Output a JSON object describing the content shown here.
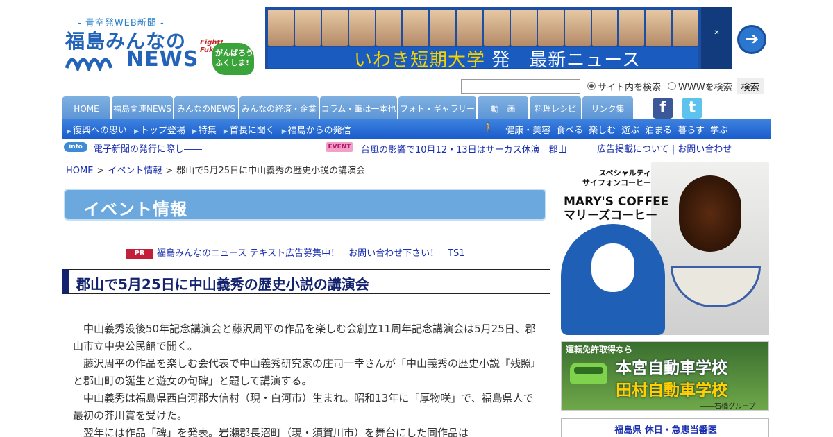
{
  "header": {
    "tagline": "- 青空発WEB新聞 -",
    "site_name": "福島みんなの",
    "site_news": "NEWS",
    "fight_label": "Fight! Fukushima",
    "ganbarou": "がんばろう ふくしま!",
    "banner_text_yellow": "いわき短期大学",
    "banner_text_white": "発　最新ニュース",
    "banner_school_logo": "いわき短期大学"
  },
  "search": {
    "radio_site": "サイト内を検索",
    "radio_www": "WWWを検索",
    "button": "検索",
    "selected": "site"
  },
  "nav": {
    "tabs": [
      "HOME",
      "福島関連NEWS",
      "みんなのNEWS",
      "みんなの経済・企業",
      "コラム・筆は一本也",
      "フォト・ギャラリー",
      "動　画",
      "料理レシピ",
      "リンク集"
    ],
    "social": [
      "facebook",
      "twitter"
    ]
  },
  "subnav": {
    "left": [
      "復興への思い",
      "トップ登場",
      "特集",
      "首長に聞く",
      "福島からの発信"
    ],
    "right": [
      "健康・美容",
      "食べる",
      "楽しむ",
      "遊ぶ",
      "泊まる",
      "暮らす",
      "学ぶ"
    ]
  },
  "infobar": {
    "info_badge": "info",
    "info_text": "電子新聞の発行に際し――",
    "event_badge": "EVENT",
    "event_text": "台風の影響で10月12・13日はサーカス休演　郡山",
    "ad_link": "広告掲載について",
    "sep": "|",
    "contact_link": "お問い合わせ"
  },
  "breadcrumb": [
    "HOME",
    "イベント情報",
    "郡山で5月25日に中山義秀の歴史小説の講演会"
  ],
  "breadcrumb_sep": ">",
  "category": "イベント情報",
  "pr": {
    "badge": "PR",
    "text": "福島みんなのニュース テキスト広告募集中！　お問い合わせ下さい！　TS1"
  },
  "article": {
    "title": "郡山で5月25日に中山義秀の歴史小説の講演会",
    "paragraphs": [
      "中山義秀没後50年記念講演会と藤沢周平の作品を楽しむ会創立11周年記念講演会は5月25日、郡山市立中央公民館で開く。",
      "藤沢周平の作品を楽しむ会代表で中山義秀研究家の庄司一幸さんが「中山義秀の歴史小説『残照』と郡山町の誕生と遊女の句碑」と題して講演する。",
      "中山義秀は福島県西白河郡大信村（現・白河市）生まれ。昭和13年に「厚物咲」で、福島県人で最初の芥川賞を受けた。",
      "翌年には作品「碑」を発表。岩瀬郡長沼町（現・須賀川市）を舞台にした同作品は"
    ]
  },
  "sidebar": {
    "coffee_ad": {
      "line1": "スペシャルティ\nサイフォンコーヒー",
      "brand": "MARY'S COFFEE",
      "brand_jp": "マリーズコーヒー"
    },
    "driving_ad": {
      "line1": "運転免許取得なら",
      "school1": "本宮自動車学校",
      "school2": "田村自動車学校",
      "group": "――石橋グループ"
    },
    "duty_title": "福島県 休日・急患当番医"
  }
}
